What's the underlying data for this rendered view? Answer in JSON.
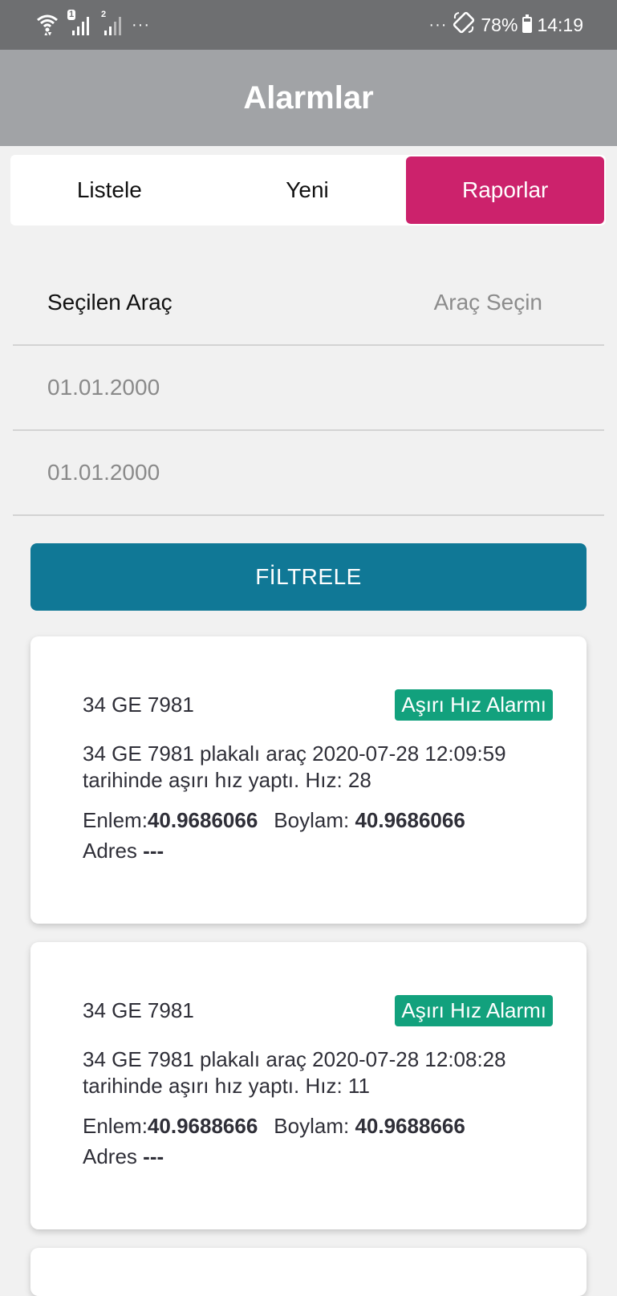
{
  "status_bar": {
    "sim1": "1",
    "sim2": "2",
    "dots_left": "···",
    "dots_right": "···",
    "battery": "78%",
    "time": "14:19"
  },
  "app_bar": {
    "title": "Alarmlar"
  },
  "tabs": [
    {
      "label": "Listele",
      "active": false
    },
    {
      "label": "Yeni",
      "active": false
    },
    {
      "label": "Raporlar",
      "active": true
    }
  ],
  "form": {
    "vehicle_label": "Seçilen Araç",
    "vehicle_placeholder": "Araç Seçin",
    "start_date": "01.01.2000",
    "end_date": "01.01.2000"
  },
  "filter_button": "FİLTRELE",
  "alarms": [
    {
      "plate": "34 GE 7981",
      "type": "Aşırı Hız Alarmı",
      "desc_line1": "34 GE 7981 plakalı araç 2020-07-28 12:09:59",
      "desc_line2": "tarihinde aşırı hız yaptı. Hız: 28",
      "lat_label": "Enlem:",
      "lat": "40.9686066",
      "lon_label": "Boylam:",
      "lon": "40.9686066",
      "address_label": "Adres",
      "address": "---"
    },
    {
      "plate": "34 GE 7981",
      "type": "Aşırı Hız Alarmı",
      "desc_line1": "34 GE 7981 plakalı araç 2020-07-28 12:08:28",
      "desc_line2": "tarihinde aşırı hız yaptı. Hız: 11",
      "lat_label": "Enlem:",
      "lat": "40.9688666",
      "lon_label": "Boylam:",
      "lon": "40.9688666",
      "address_label": "Adres",
      "address": "---"
    }
  ],
  "colors": {
    "status_bar": "#6e6f71",
    "app_bar": "#a1a3a6",
    "active_tab": "#cc226c",
    "filter_button": "#107896",
    "badge": "#12a17d"
  }
}
